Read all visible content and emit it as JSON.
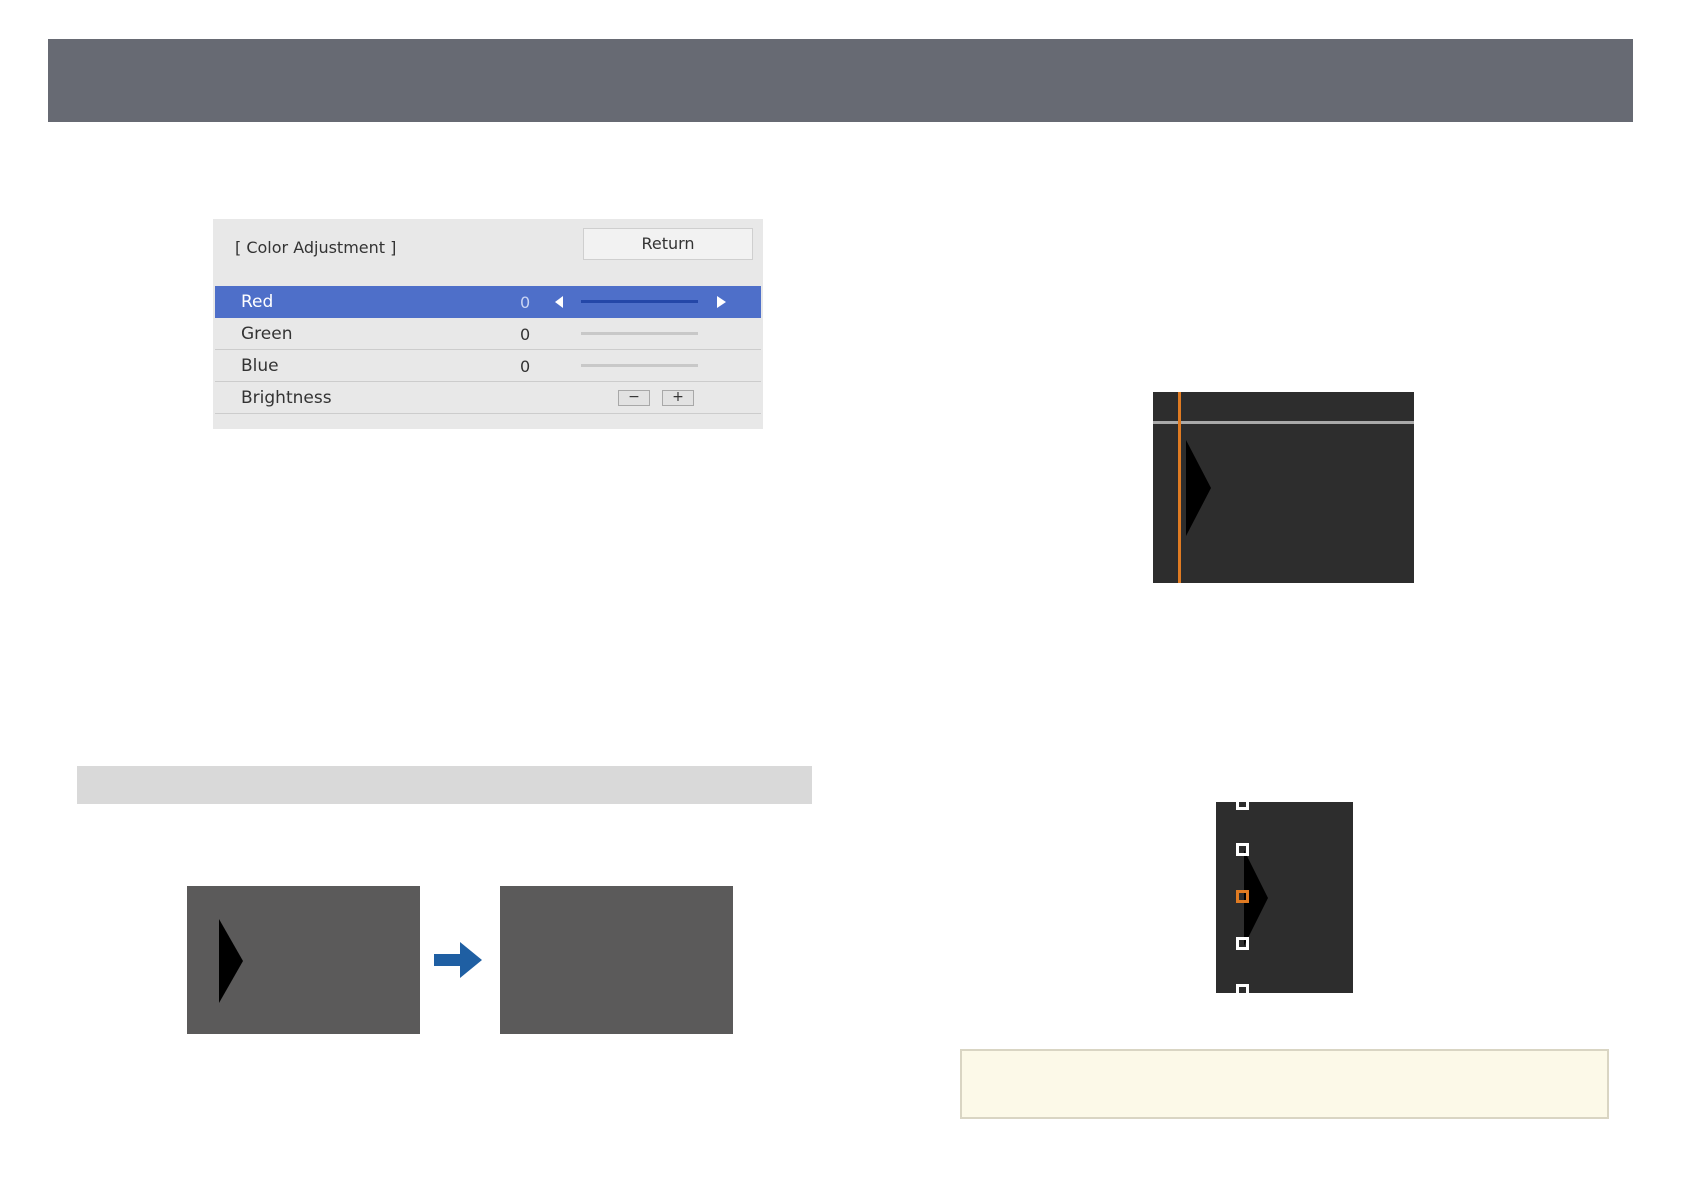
{
  "menu": {
    "title": "[ Color Adjustment ]",
    "return_label": "Return",
    "rows": [
      {
        "label": "Red",
        "value": "0",
        "selected": true
      },
      {
        "label": "Green",
        "value": "0",
        "selected": false
      },
      {
        "label": "Blue",
        "value": "0",
        "selected": false
      },
      {
        "label": "Brightness"
      }
    ],
    "brightness_minus": "−",
    "brightness_plus": "+"
  },
  "colors": {
    "banner": "#676a73",
    "selected_row": "#4e6fc9",
    "highlight_line": "#e07b22",
    "arrow": "#1f5fa3",
    "note_background": "#fcf9e8"
  }
}
